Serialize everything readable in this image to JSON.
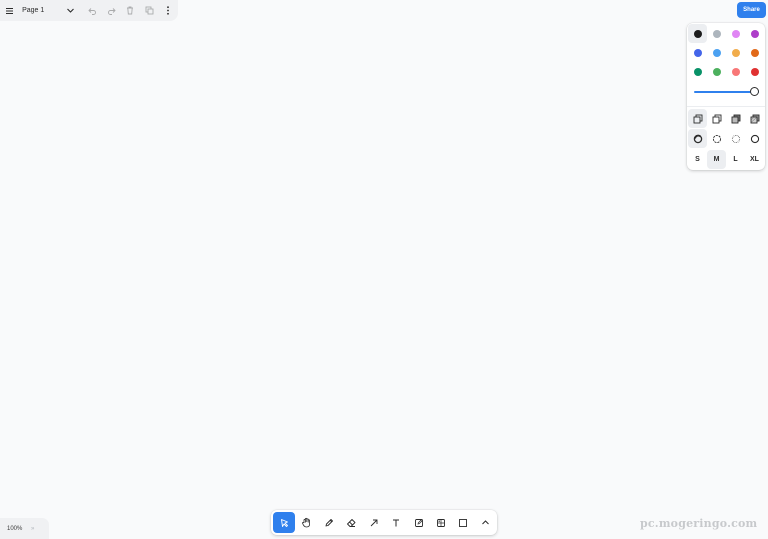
{
  "menu": {
    "menu_icon": "hamburger-icon",
    "page_name": "Page 1",
    "chevron_icon": "chevron-down-icon",
    "actions": [
      "undo-icon",
      "redo-icon",
      "trash-icon",
      "duplicate-icon",
      "more-vertical-icon"
    ]
  },
  "share": {
    "label": "Share",
    "color": "#2f80ed"
  },
  "style_panel": {
    "colors": [
      [
        "#1d1d1d",
        "#adb5bd",
        "#e085f4",
        "#ae3ec9"
      ],
      [
        "#4465e9",
        "#4ba1f1",
        "#f1ac4b",
        "#e16919"
      ],
      [
        "#099268",
        "#4cb05e",
        "#f87777",
        "#e03131"
      ]
    ],
    "selected_color": "#1d1d1d",
    "opacity": 1.0,
    "fill_styles": [
      "fill-none-icon",
      "fill-semi-icon",
      "fill-solid-icon",
      "fill-pattern-icon"
    ],
    "selected_fill": 0,
    "dash_styles": [
      "dash-draw-icon",
      "dash-dashed-icon",
      "dash-dotted-icon",
      "dash-solid-icon"
    ],
    "selected_dash": 0,
    "sizes": [
      "S",
      "M",
      "L",
      "XL"
    ],
    "selected_size": 1
  },
  "toolbar": {
    "tools": [
      "select-icon",
      "hand-icon",
      "pencil-icon",
      "eraser-icon",
      "arrow-icon",
      "text-icon",
      "note-icon",
      "asset-icon",
      "rectangle-icon",
      "chevron-up-icon"
    ],
    "active_tool": 0
  },
  "zoom": {
    "label": "100%",
    "arrow": "»"
  },
  "watermark": "pc.mogeringo.com"
}
